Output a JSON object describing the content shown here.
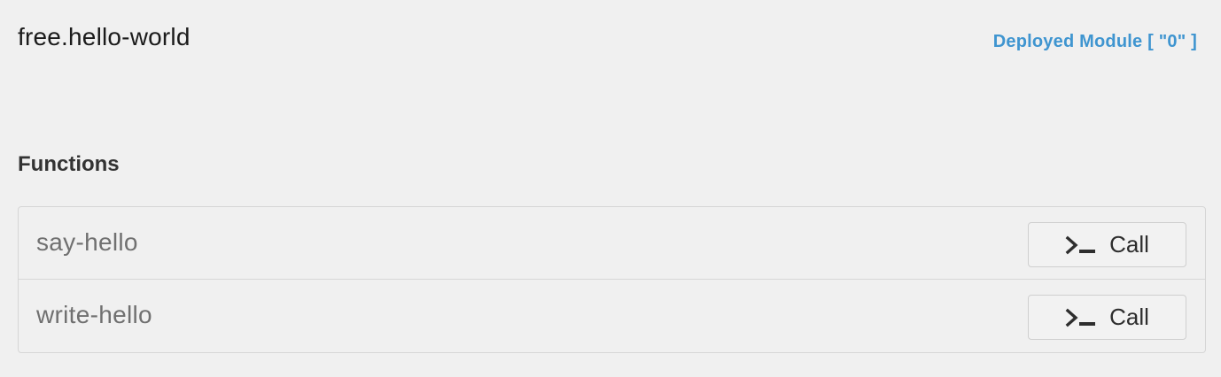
{
  "module": {
    "title": "free.hello-world",
    "deployed_label": "Deployed Module [ \"0\" ]"
  },
  "functions": {
    "heading": "Functions",
    "items": [
      {
        "name": "say-hello",
        "action_label": "Call",
        "action_icon": "terminal-prompt-icon"
      },
      {
        "name": "write-hello",
        "action_label": "Call",
        "action_icon": "terminal-prompt-icon"
      }
    ]
  },
  "colors": {
    "background": "#f0f0f0",
    "link": "#3f95d0",
    "border": "#d6d6d6",
    "function_name": "#707070"
  }
}
